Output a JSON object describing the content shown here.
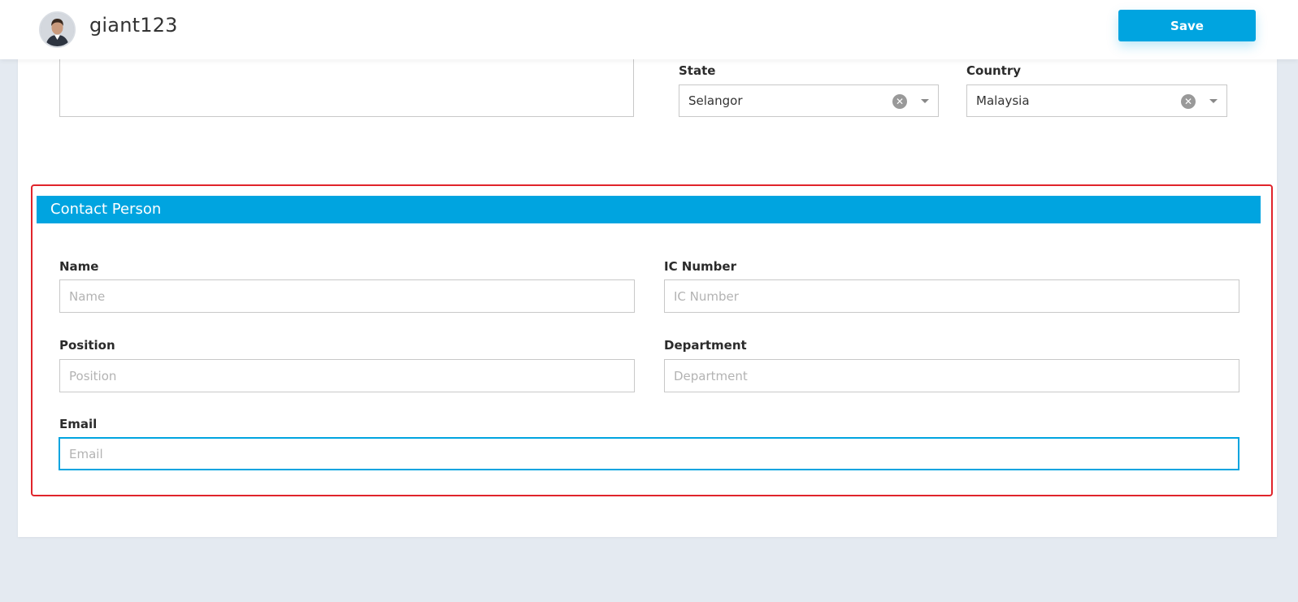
{
  "header": {
    "username": "giant123",
    "save_label": "Save"
  },
  "address": {
    "state": {
      "label": "State",
      "value": "Selangor"
    },
    "country": {
      "label": "Country",
      "value": "Malaysia"
    }
  },
  "contact_person": {
    "title": "Contact Person",
    "fields": {
      "name": {
        "label": "Name",
        "placeholder": "Name",
        "value": ""
      },
      "ic_number": {
        "label": "IC Number",
        "placeholder": "IC Number",
        "value": ""
      },
      "position": {
        "label": "Position",
        "placeholder": "Position",
        "value": ""
      },
      "department": {
        "label": "Department",
        "placeholder": "Department",
        "value": ""
      },
      "email": {
        "label": "Email",
        "placeholder": "Email",
        "value": ""
      }
    }
  },
  "icons": {
    "clear": "clear-icon",
    "dropdown": "chevron-down-icon",
    "avatar": "user-avatar"
  },
  "colors": {
    "accent": "#00a4e0",
    "highlight_border": "#e0242b",
    "page_background": "#e4eaf1"
  }
}
